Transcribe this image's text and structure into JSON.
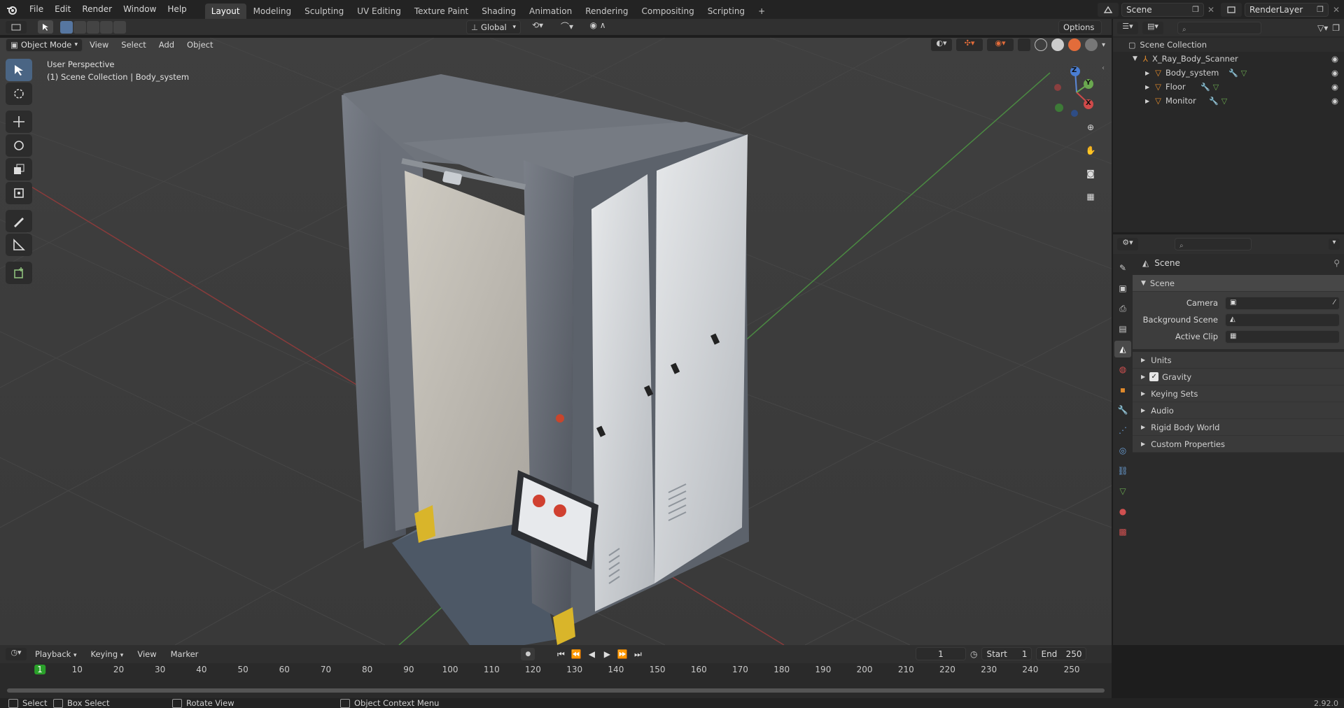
{
  "topbar": {
    "menus": [
      "File",
      "Edit",
      "Render",
      "Window",
      "Help"
    ],
    "workspaces": [
      "Layout",
      "Modeling",
      "Sculpting",
      "UV Editing",
      "Texture Paint",
      "Shading",
      "Animation",
      "Rendering",
      "Compositing",
      "Scripting"
    ],
    "active_workspace": "Layout",
    "add_tab": "+",
    "scene_name": "Scene",
    "render_layer": "RenderLayer"
  },
  "viewport_header": {
    "mode": "Object Mode",
    "menus": [
      "View",
      "Select",
      "Add",
      "Object"
    ],
    "transform_orientation": "Global",
    "options": "Options"
  },
  "viewport": {
    "perspective_label": "User Perspective",
    "collection_label": "(1) Scene Collection | Body_system",
    "axes": {
      "z": "Z",
      "y": "Y",
      "x": "X"
    }
  },
  "outliner": {
    "root": "Scene Collection",
    "collection": "X_Ray_Body_Scanner",
    "items": [
      "Body_system",
      "Floor",
      "Monitor"
    ]
  },
  "properties": {
    "breadcrumb": "Scene",
    "section": "Scene",
    "camera_label": "Camera",
    "camera_value": "",
    "background_scene_label": "Background Scene",
    "background_scene_value": "",
    "active_clip_label": "Active Clip",
    "active_clip_value": "",
    "panels": [
      "Units",
      "Gravity",
      "Keying Sets",
      "Audio",
      "Rigid Body World",
      "Custom Properties"
    ],
    "gravity_checked": true
  },
  "timeline": {
    "menus": [
      "Playback",
      "Keying",
      "View",
      "Marker"
    ],
    "current_frame": "1",
    "start_label": "Start",
    "start": "1",
    "end_label": "End",
    "end": "250",
    "ruler": [
      "1",
      "10",
      "20",
      "30",
      "40",
      "50",
      "60",
      "70",
      "80",
      "90",
      "100",
      "110",
      "120",
      "130",
      "140",
      "150",
      "160",
      "170",
      "180",
      "190",
      "200",
      "210",
      "220",
      "230",
      "240",
      "250"
    ]
  },
  "statusbar": {
    "select": "Select",
    "box_select": "Box Select",
    "rotate_view": "Rotate View",
    "context_menu": "Object Context Menu",
    "version": "2.92.0"
  },
  "colors": {
    "accent": "#4a6584",
    "active_frame": "#2aa12a",
    "object_orange": "#e08a2c",
    "viewport_bg": "#3d3d3d"
  }
}
